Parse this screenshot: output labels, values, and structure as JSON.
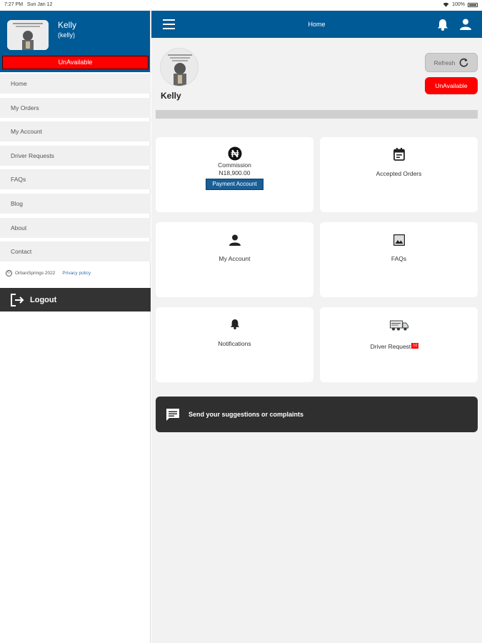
{
  "status_bar": {
    "time": "7:27 PM",
    "date": "Sun Jan 12",
    "battery": "100%"
  },
  "sidebar": {
    "name": "Kelly",
    "username": "(kelly)",
    "status": "UnAvailable",
    "items": [
      {
        "label": "Home"
      },
      {
        "label": "My Orders"
      },
      {
        "label": "My Account"
      },
      {
        "label": "Driver Requests"
      },
      {
        "label": "FAQs"
      },
      {
        "label": "Blog"
      },
      {
        "label": "About"
      },
      {
        "label": "Contact"
      }
    ],
    "copyright": "OrbanSprings 2022",
    "privacy": "Privacy policy",
    "logout": "Logout"
  },
  "header": {
    "title": "Home"
  },
  "profile": {
    "name": "Kelly",
    "refresh_label": "Refresh",
    "status_label": "UnAvailable"
  },
  "cards": {
    "commission": {
      "label": "Commission",
      "amount": "N18,900.00",
      "button": "Payment Account",
      "icon": "naira-icon"
    },
    "accepted_orders": {
      "label": "Accepted Orders",
      "icon": "calendar-icon"
    },
    "my_account": {
      "label": "My Account",
      "icon": "person-icon"
    },
    "faqs": {
      "label": "FAQs",
      "icon": "image-icon"
    },
    "notifications": {
      "label": "Notifications",
      "icon": "bell-icon"
    },
    "driver_requests": {
      "label": "Driver Request",
      "badge": "10",
      "icon": "truck-icon"
    }
  },
  "suggestion": {
    "label": "Send your suggestions or complaints"
  },
  "colors": {
    "primary": "#005a96",
    "danger": "#ff0000",
    "dark": "#333333",
    "background": "#f2f2f2"
  }
}
